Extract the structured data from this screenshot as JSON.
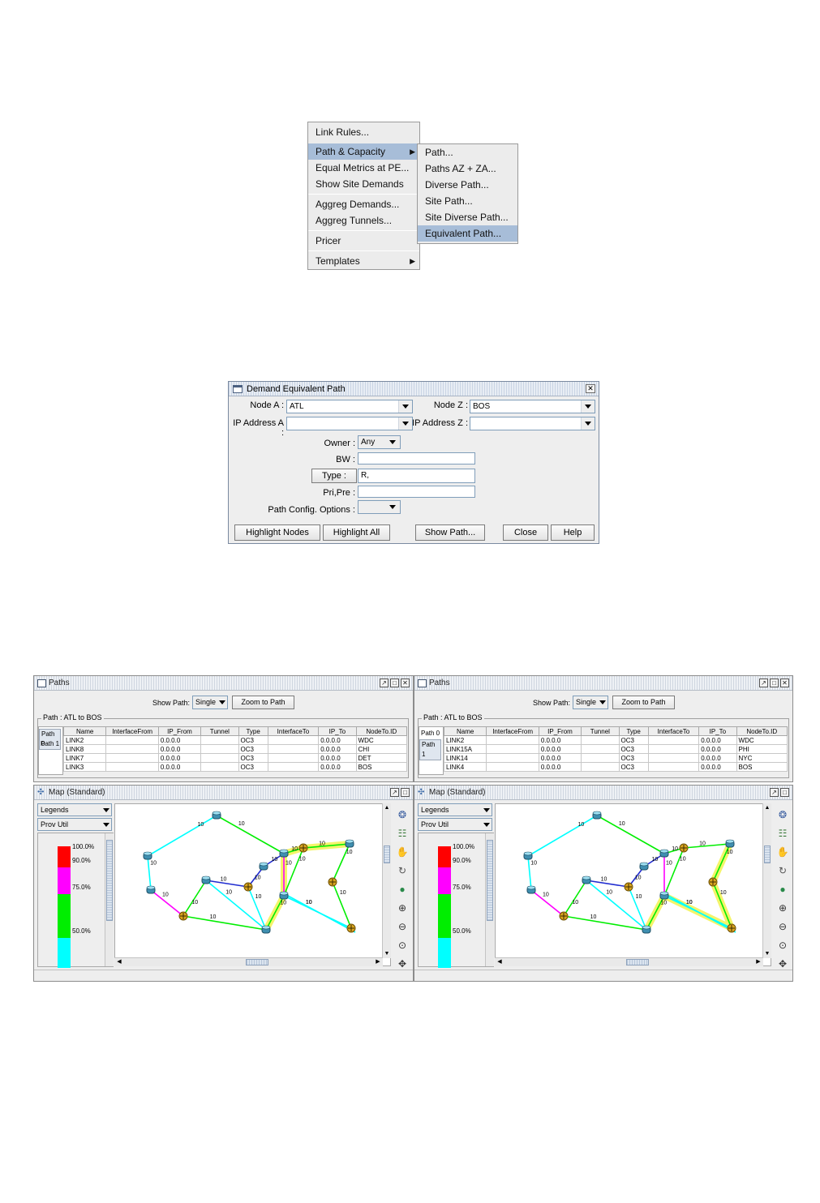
{
  "menu": {
    "items": [
      "Link Rules...",
      "Path & Capacity",
      "Equal Metrics at PE...",
      "Show Site Demands",
      "Aggreg Demands...",
      "Aggreg Tunnels...",
      "Pricer",
      "Templates"
    ],
    "submenu": [
      "Path...",
      "Paths AZ + ZA...",
      "Diverse Path...",
      "Site Path...",
      "Site Diverse Path...",
      "Equivalent Path..."
    ]
  },
  "dialog": {
    "title": "Demand Equivalent Path",
    "node_a_label": "Node A :",
    "node_a_value": "ATL",
    "node_z_label": "Node Z :",
    "node_z_value": "BOS",
    "ip_a_label": "IP Address A :",
    "ip_z_label": "IP Address Z :",
    "owner_label": "Owner :",
    "owner_value": "Any",
    "bw_label": "BW :",
    "type_button": "Type :",
    "type_value": "R,",
    "pripre_label": "Pri,Pre :",
    "config_label": "Path Config. Options :",
    "buttons": {
      "highlight_nodes": "Highlight Nodes",
      "highlight_all": "Highlight All",
      "show_path": "Show Path...",
      "close": "Close",
      "help": "Help"
    }
  },
  "paths_panels": [
    {
      "title": "Paths",
      "show_path_label": "Show Path:",
      "show_path_value": "Single",
      "zoom_button": "Zoom to Path",
      "group_label": "Path : ATL to BOS",
      "tabs": [
        "Path 0",
        "Path 1"
      ],
      "selected_tab": 0,
      "columns": [
        "Name",
        "InterfaceFrom",
        "IP_From",
        "Tunnel",
        "Type",
        "InterfaceTo",
        "IP_To",
        "NodeTo.ID"
      ],
      "rows": [
        [
          "LINK2",
          "",
          "0.0.0.0",
          "",
          "OC3",
          "",
          "0.0.0.0",
          "WDC"
        ],
        [
          "LINK8",
          "",
          "0.0.0.0",
          "",
          "OC3",
          "",
          "0.0.0.0",
          "CHI"
        ],
        [
          "LINK7",
          "",
          "0.0.0.0",
          "",
          "OC3",
          "",
          "0.0.0.0",
          "DET"
        ],
        [
          "LINK3",
          "",
          "0.0.0.0",
          "",
          "OC3",
          "",
          "0.0.0.0",
          "BOS"
        ]
      ]
    },
    {
      "title": "Paths",
      "show_path_label": "Show Path:",
      "show_path_value": "Single",
      "zoom_button": "Zoom to Path",
      "group_label": "Path : ATL to BOS",
      "tabs": [
        "Path 0",
        "Path 1"
      ],
      "selected_tab": 1,
      "columns": [
        "Name",
        "InterfaceFrom",
        "IP_From",
        "Tunnel",
        "Type",
        "InterfaceTo",
        "IP_To",
        "NodeTo.ID"
      ],
      "rows": [
        [
          "LINK2",
          "",
          "0.0.0.0",
          "",
          "OC3",
          "",
          "0.0.0.0",
          "WDC"
        ],
        [
          "LINK15A",
          "",
          "0.0.0.0",
          "",
          "OC3",
          "",
          "0.0.0.0",
          "PHI"
        ],
        [
          "LINK14",
          "",
          "0.0.0.0",
          "",
          "OC3",
          "",
          "0.0.0.0",
          "NYC"
        ],
        [
          "LINK4",
          "",
          "0.0.0.0",
          "",
          "OC3",
          "",
          "0.0.0.0",
          "BOS"
        ]
      ]
    }
  ],
  "map_panels": [
    {
      "title": "Map (Standard)",
      "legends_select": "Legends",
      "util_select": "Prov Util",
      "legend": [
        "100.0%",
        "90.0%",
        "75.0%",
        "50.0%"
      ],
      "link_metric": "10"
    },
    {
      "title": "Map (Standard)",
      "legends_select": "Legends",
      "util_select": "Prov Util",
      "legend": [
        "100.0%",
        "90.0%",
        "75.0%",
        "50.0%"
      ],
      "link_metric": "10"
    }
  ],
  "colors": {
    "red": "#ff0000",
    "magenta": "#ff00ff",
    "green": "#00ee00",
    "cyan": "#00ffff",
    "menu_highlight": "#a7bdd8",
    "path_highlight": "#f4f46a"
  }
}
